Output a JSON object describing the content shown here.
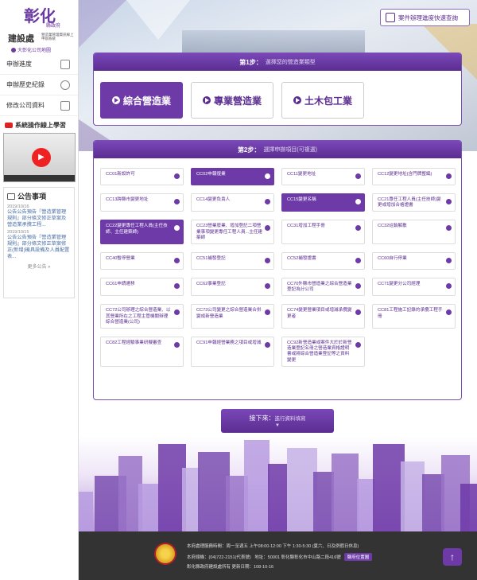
{
  "logo": {
    "main": "彰化",
    "county": "縣政府",
    "bureau": "建設處",
    "sub": "營造業管理資訊線上申辦系統",
    "link": "大彰化公司地圖"
  },
  "sidebar": {
    "items": [
      {
        "label": "申辦進度",
        "icon": "copy-icon"
      },
      {
        "label": "申辦歷史紀錄",
        "icon": "history-icon"
      },
      {
        "label": "修改公司資料",
        "icon": "building-icon"
      }
    ],
    "learn": "系統操作線上學習"
  },
  "notice": {
    "title": "公告事項",
    "items": [
      {
        "date": "2019/10/16",
        "text": "公告公告預告『營造業管理規則』部分條文修正草案及營造業承攬工程..."
      },
      {
        "date": "2019/10/15",
        "text": "公告公告預告『營造業管理規則』部分條文修正草案修正(新增)機具設備及人員配置表..."
      }
    ],
    "more": "更多公告 »"
  },
  "quick": "案件辦理進度快速查詢",
  "step1": {
    "num": "第1步：",
    "hint": "選擇您的營造業類型",
    "options": [
      {
        "label": "綜合營造業",
        "on": true
      },
      {
        "label": "專業營造業",
        "on": false
      },
      {
        "label": "土木包工業",
        "on": false
      }
    ]
  },
  "step2": {
    "num": "第2步：",
    "hint": "選擇申辦項目(可複選)",
    "items": [
      {
        "label": "CC01新設許可",
        "on": false
      },
      {
        "label": "CC02申報復業",
        "on": true
      },
      {
        "label": "CC11變更地址",
        "on": false
      },
      {
        "label": "CC12變更地址(含門牌整編)",
        "on": false
      },
      {
        "label": "CC13跨縣市變更地址",
        "on": false
      },
      {
        "label": "CC14變更負責人",
        "on": false
      },
      {
        "label": "CC15變更名稱",
        "on": true
      },
      {
        "label": "CC21專任工程人員(主任技師)變更或增加合格證書",
        "on": false
      },
      {
        "label": "CC22變更專任工程人員(主任技師、主任建築師)",
        "on": true
      },
      {
        "label": "CC23營業廢業、增加登記二項營業事項變更專任工程人員...主任建築師",
        "on": false
      },
      {
        "label": "CC31增加工程手冊",
        "on": false
      },
      {
        "label": "CC32註銷解散",
        "on": false
      },
      {
        "label": "CC40暫停營業",
        "on": false
      },
      {
        "label": "CC51補發登記",
        "on": false
      },
      {
        "label": "CC52補發證書",
        "on": false
      },
      {
        "label": "CC60自行停業",
        "on": false
      },
      {
        "label": "CC61申請遷移",
        "on": false
      },
      {
        "label": "CC62事業登記",
        "on": false
      },
      {
        "label": "CC70外縣市營造業之綜合營造業登記為分公司",
        "on": false
      },
      {
        "label": "CC71變更分公司經理",
        "on": false
      },
      {
        "label": "CC72公司辦理之綜合營造業、以其營業所在之工程主管機關辦理綜合營造業(公司)",
        "on": false
      },
      {
        "label": "CC73公司變更之綜合營造業合併變成新營造業",
        "on": false
      },
      {
        "label": "CC74變更營業項目或增減承攬變更者",
        "on": false
      },
      {
        "label": "CC81工程施工記錄的承攬工程手冊",
        "on": false
      },
      {
        "label": "CC82工程經驗事業研擬審查",
        "on": false
      },
      {
        "label": "CC91申報經營業務之項目或增減",
        "on": false
      },
      {
        "label": "CC92新營造業或案件大於於新營造業登記名冊之營造業資格證明書或將綜合營造業登記等之資料變更",
        "on": false
      }
    ]
  },
  "next": {
    "label": "接下來：",
    "hint": "進行資料填寫"
  },
  "footer": {
    "hours": "本府處理服務時間：周一至週五 上午08:00-12:00 下午 1:30-5:30 (夏六、日及例假日休息)",
    "phone": "本府總機：(04)722-2151(代表號)",
    "address": "地址：50001 彰化縣彰化市中山路二段416號",
    "map": "縣府位置圖",
    "copy": "彰化縣政府建設處所有  更新日期：108-10-16"
  }
}
